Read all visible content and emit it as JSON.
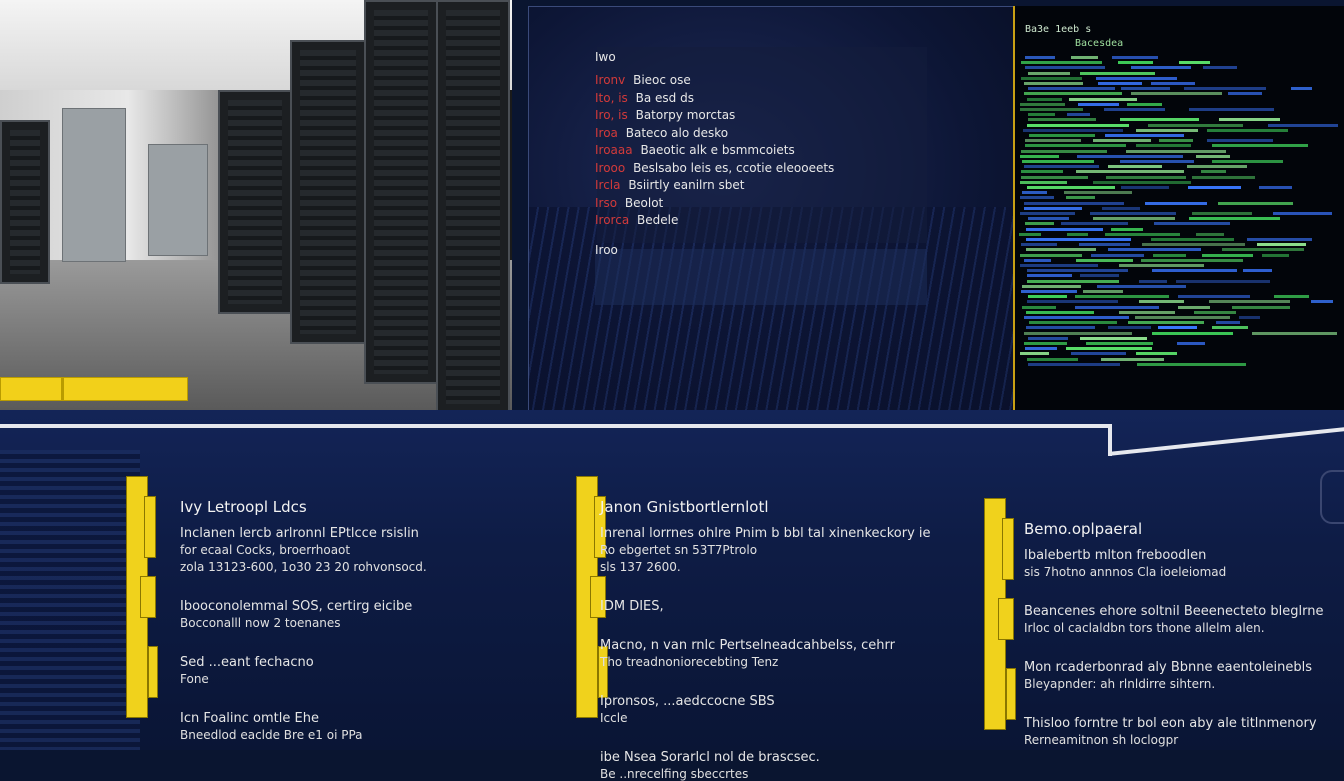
{
  "top_left": {
    "scene": "server-room-photo"
  },
  "overview": {
    "heading": "Iwo",
    "items": [
      "Ironv",
      "Ito, is",
      "Iro, is",
      "Iroa",
      "Iroaaa",
      "Irooo",
      "Ircla",
      "Irso",
      "Irorca"
    ],
    "item_texts": [
      "Bieoc ose",
      "Ba esd ds",
      "Batorpy morctas",
      "Bateco alo desko",
      "Baeotic alk e bsmmcoiets",
      "Beslsabo leis es, ccotie eleooeets",
      "Bsiirtly eanilrn sbet",
      "Beolot",
      "Bedele"
    ],
    "footer": "Iroo"
  },
  "terminal": {
    "header": "Ba3e 1eeb s",
    "header_sub": "Bacesdea"
  },
  "columns": [
    {
      "title": "Ivy Letroopl Ldcs",
      "groups": [
        [
          "Inclanen lercb arlronnl EPtlcce rsislin",
          "for ecaal Cocks, broerrhoaot",
          "zola 13123-600, 1o30 23 20 rohvonsocd."
        ],
        [
          "Ibooconolemmal SOS, certirg eicibe",
          "Bocconalll now 2 toenanes"
        ],
        [
          "Sed ...eant fechacno",
          "Fone"
        ],
        [
          "Icn Foalinc omtle Ehe",
          "Bneedlod eaclde Bre e1 oi  PPa"
        ]
      ]
    },
    {
      "title": "Janon Gnistbortlernlotl",
      "groups": [
        [
          "Inrenal lorrnes ohlre Pnim b bbl tal xinenkeckory ie",
          "Ro ebgertet sn 53T7Ptrolo",
          "sls 137 2600."
        ],
        [
          "IDM DIES,"
        ],
        [
          "Macno, n van rnlc Pertselneadcahbelss, cehrr",
          "Tho treadnoniorecebting Tenz"
        ],
        [
          "Ipronsos, ...aedccocne SBS",
          "Iccle"
        ],
        [
          "ibe Nsea Sorarlcl nol de brascsec.",
          "Be ..nrecelfing sbeccrtes"
        ]
      ]
    },
    {
      "title": "Bemo.oplpaeral",
      "groups": [
        [
          "Ibalebertb mlton freboodlen",
          "sis 7hotno annnos Cla ioeleiomad"
        ],
        [
          "Beancenes ehore soltnil Beeenecteto bleglrne",
          "Irloc ol caclaldbn tors thone allelm alen."
        ],
        [
          "Mon rcaderbonrad aly Bbnne eaentoleinebls",
          "Bleyapnder: ah rlnldirre sihtern."
        ],
        [
          "Thisloo forntre tr bol eon aby ale titlnmenory",
          "Rerneamitnon sh loclogpr"
        ]
      ]
    }
  ],
  "colors": {
    "accent_yellow": "#f0d21c",
    "navy": "#0e1c45",
    "terminal_green": "#3fd05a",
    "terminal_blue": "#3a78ff"
  }
}
